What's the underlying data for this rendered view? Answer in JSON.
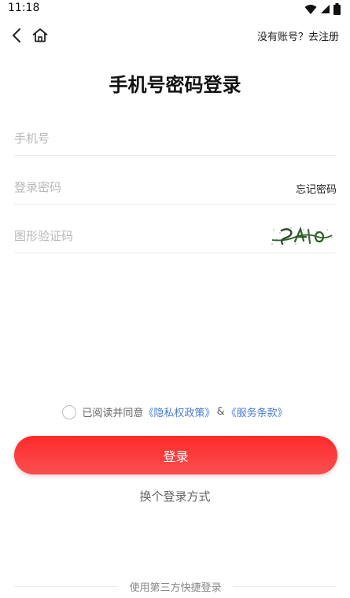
{
  "status_bar": {
    "time": "11:18",
    "icons": [
      "wifi-icon",
      "signal-icon",
      "battery-icon"
    ]
  },
  "nav": {
    "back_icon": "chevron-left-icon",
    "home_icon": "home-icon",
    "register_link": "没有账号？去注册"
  },
  "title": "手机号密码登录",
  "form": {
    "phone_placeholder": "手机号",
    "password_placeholder": "登录密码",
    "forgot_password": "忘记密码",
    "captcha_placeholder": "图形验证码"
  },
  "agreement": {
    "prefix": "已阅读并同意",
    "privacy_policy": "《隐私权政策》",
    "ampersand": "&",
    "terms": "《服务条款》"
  },
  "login_button": "登录",
  "switch_login": "换个登录方式",
  "third_party_label": "使用第三方快捷登录",
  "colors": {
    "accent": "#ff2a2a",
    "link": "#4a7bd0"
  }
}
